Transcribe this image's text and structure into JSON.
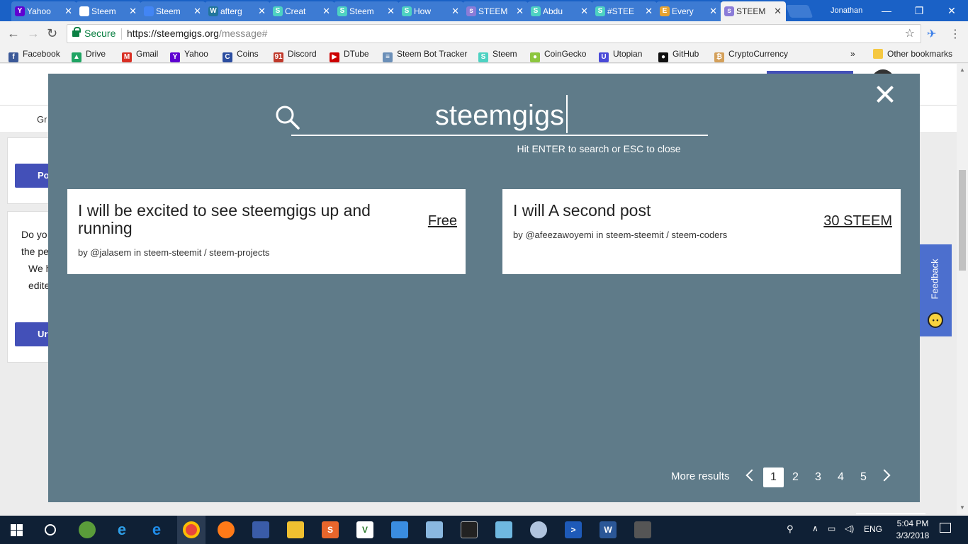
{
  "browser": {
    "tabs": [
      {
        "label": "Yahoo",
        "favicon": "Y",
        "color": "#5f01d1"
      },
      {
        "label": "Steem",
        "favicon": "doc",
        "color": "#ffffff"
      },
      {
        "label": "Steem",
        "favicon": "doc",
        "color": "#4285f4"
      },
      {
        "label": "afterg",
        "favicon": "W",
        "color": "#21759b"
      },
      {
        "label": "Creat",
        "favicon": "S",
        "color": "#4ed2c2"
      },
      {
        "label": "Steem",
        "favicon": "S",
        "color": "#4ed2c2"
      },
      {
        "label": "How",
        "favicon": "S",
        "color": "#4ed2c2"
      },
      {
        "label": "STEEM",
        "favicon": "s",
        "color": "#8b7cd8"
      },
      {
        "label": "Abdu",
        "favicon": "S",
        "color": "#4ed2c2"
      },
      {
        "label": "#STEE",
        "favicon": "S",
        "color": "#4ed2c2"
      },
      {
        "label": "Every",
        "favicon": "E",
        "color": "#e8a330"
      },
      {
        "label": "STEEM",
        "favicon": "s",
        "color": "#8b7cd8",
        "active": true
      }
    ],
    "profile_name": "Jonathan",
    "secure_label": "Secure",
    "url_host": "https://steemgigs.org",
    "url_path": "/message#",
    "bookmarks": [
      {
        "label": "Facebook",
        "icon": "f",
        "color": "#3b5998"
      },
      {
        "label": "Drive",
        "icon": "▲",
        "color": "#1fa463"
      },
      {
        "label": "Gmail",
        "icon": "M",
        "color": "#d93025"
      },
      {
        "label": "Yahoo",
        "icon": "Y",
        "color": "#5f01d1"
      },
      {
        "label": "Coins",
        "icon": "C",
        "color": "#2b4da0"
      },
      {
        "label": "Discord",
        "icon": "91",
        "color": "#c0392b"
      },
      {
        "label": "DTube",
        "icon": "▶",
        "color": "#c00"
      },
      {
        "label": "Steem Bot Tracker",
        "icon": "≡",
        "color": "#6b8fb8"
      },
      {
        "label": "Steem",
        "icon": "S",
        "color": "#4ed2c2"
      },
      {
        "label": "CoinGecko",
        "icon": "●",
        "color": "#8dc63f"
      },
      {
        "label": "Utopian",
        "icon": "U",
        "color": "#4a4ad8"
      },
      {
        "label": "GitHub",
        "icon": "●",
        "color": "#111"
      },
      {
        "label": "CryptoCurrency",
        "icon": "₿",
        "color": "#d4a05a"
      }
    ],
    "bookmarks_overflow": "»",
    "other_bookmarks": "Other bookmarks"
  },
  "background_page": {
    "subnav_text": "Gr",
    "button1": "Po",
    "button2": "Ur",
    "text_lines": [
      "Do yo",
      "the pe",
      "We h",
      "edite"
    ]
  },
  "search": {
    "query": "steemgigs",
    "hint": "Hit ENTER to search or ESC to close",
    "results": [
      {
        "title": "I will be excited to see steemgigs up and running",
        "author": "@jalasem",
        "in_label": "in",
        "category": "steem-steemit / steem-projects",
        "price": "Free"
      },
      {
        "title": "I will A second post",
        "author": "@afeezawoyemi",
        "in_label": "in",
        "category": "steem-steemit / steem-coders",
        "price": "30 STEEM"
      }
    ],
    "more_results_label": "More results",
    "pages": [
      "1",
      "2",
      "3",
      "4",
      "5"
    ],
    "current_page": 1
  },
  "feedback": {
    "label": "Feedback"
  },
  "taskbar": {
    "language": "ENG",
    "time": "5:04 PM",
    "date": "3/3/2018"
  }
}
